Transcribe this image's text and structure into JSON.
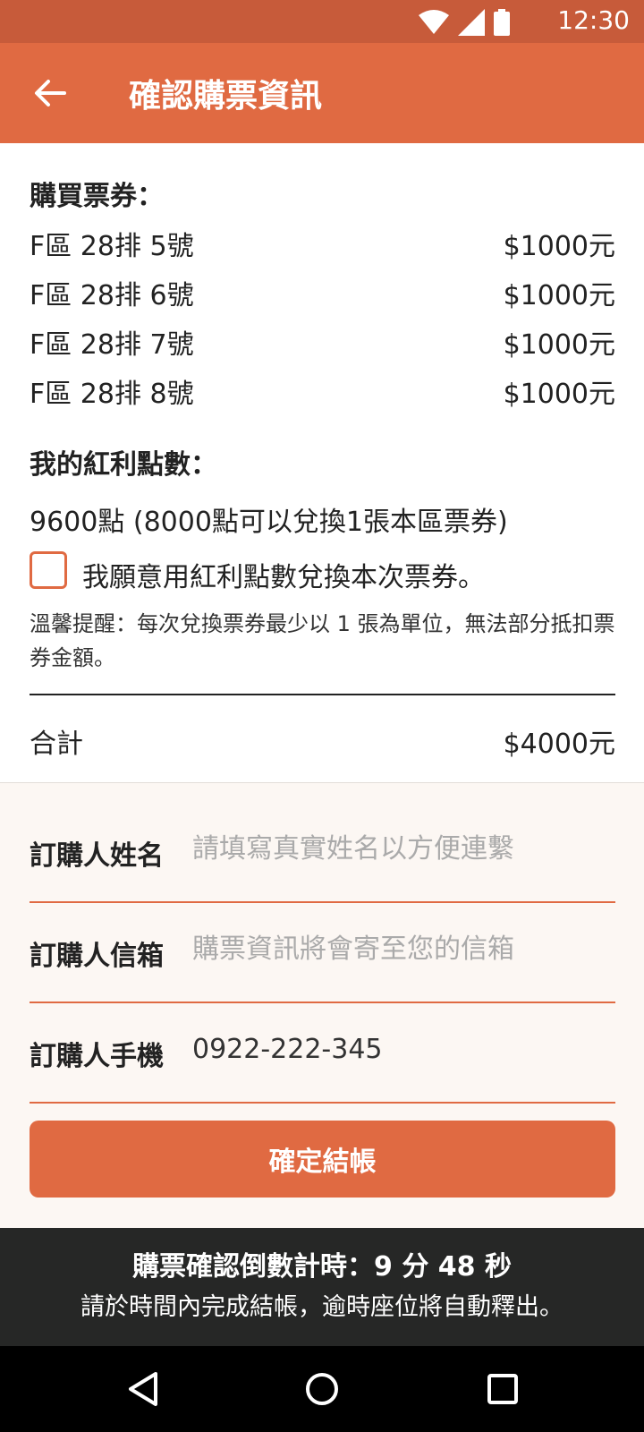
{
  "status_bar": {
    "time": "12:30",
    "icons": [
      "wifi-icon",
      "signal-icon",
      "battery-icon"
    ]
  },
  "app_bar": {
    "title": "確認購票資訊",
    "back_icon": "arrow-left-icon"
  },
  "tickets": {
    "heading": "購買票券：",
    "items": [
      {
        "seat": "F區 28排 5號",
        "price": "$1000元"
      },
      {
        "seat": "F區 28排 6號",
        "price": "$1000元"
      },
      {
        "seat": "F區 28排 7號",
        "price": "$1000元"
      },
      {
        "seat": "F區 28排 8號",
        "price": "$1000元"
      }
    ]
  },
  "bonus": {
    "heading": "我的紅利點數：",
    "points_text": "9600點 (8000點可以兌換1張本區票券)",
    "checkbox_label": "我願意用紅利點數兌換本次票券。",
    "checkbox_checked": false,
    "notice": "溫馨提醒：每次兌換票券最少以 1 張為單位，無法部分抵扣票券金額。"
  },
  "total": {
    "label": "合計",
    "amount": "$4000元"
  },
  "form": {
    "name": {
      "label": "訂購人姓名",
      "value": "",
      "placeholder": "請填寫真實姓名以方便連繫"
    },
    "email": {
      "label": "訂購人信箱",
      "value": "",
      "placeholder": "購票資訊將會寄至您的信箱"
    },
    "phone": {
      "label": "訂購人手機",
      "value": "0922-222-345",
      "placeholder": ""
    }
  },
  "checkout_button": "確定結帳",
  "countdown": {
    "line1": "購票確認倒數計時：9 分 48 秒",
    "line2": "請於時間內完成結帳，逾時座位將自動釋出。"
  },
  "colors": {
    "primary": "#e06a42",
    "status_bar": "#c75b3a",
    "countdown_bg": "#262726",
    "form_bg": "#fcf7f3"
  },
  "nav_bar": {
    "icons": [
      "back-triangle-icon",
      "home-circle-icon",
      "recents-square-icon"
    ]
  }
}
